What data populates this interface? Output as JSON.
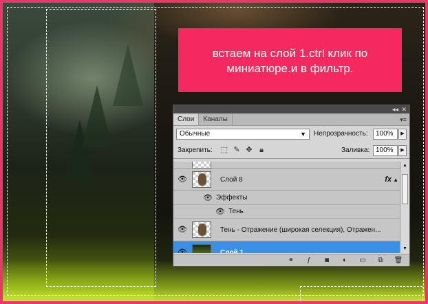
{
  "banner": {
    "text": "встаем на слой 1.ctrl клик по миниатюре.и в фильтр."
  },
  "panel": {
    "tabs": [
      {
        "label": "Слои"
      },
      {
        "label": "Каналы"
      }
    ],
    "blend_mode": "Обычные",
    "opacity_label": "Непрозрачность:",
    "opacity_value": "100%",
    "lock_label": "Закрепить:",
    "fill_label": "Заливка:",
    "fill_value": "100%",
    "layers": [
      {
        "name": "Слой 8",
        "fx": "fx"
      },
      {
        "name": "Эффекты"
      },
      {
        "name": "Тень"
      },
      {
        "name": "Тень - Отражение (широкая селекция), Отражен..."
      },
      {
        "name": "Слой 1"
      }
    ]
  },
  "colors": {
    "accent_border": "#e8386a",
    "banner_bg": "#f5295f",
    "selected_layer": "#3a8fe6"
  }
}
